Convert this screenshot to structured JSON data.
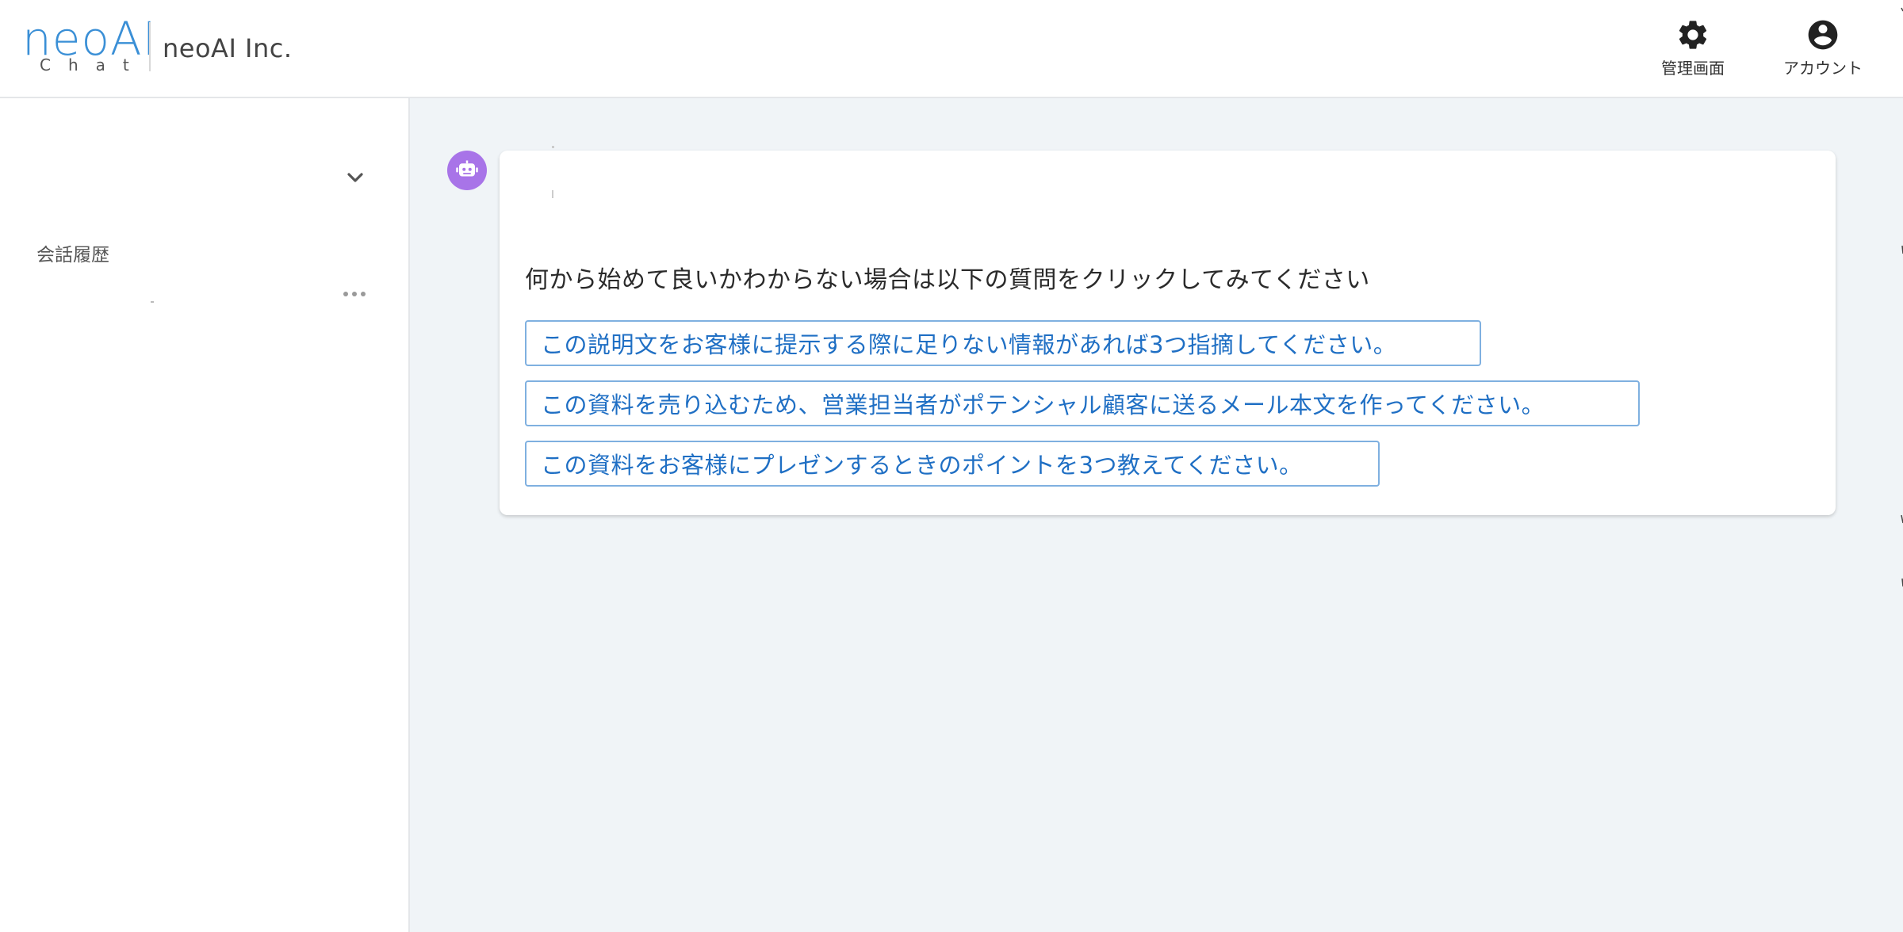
{
  "header": {
    "logo_main": "neoAI",
    "logo_sub": "Chat",
    "company": "neoAI Inc.",
    "admin_label": "管理画面",
    "account_label": "アカウント",
    "admin_icon": "gear-icon",
    "account_icon": "account-circle-icon"
  },
  "sidebar": {
    "selector_icon": "chevron-down-icon",
    "history_title": "会話履歴",
    "item_menu_icon": "more-horizontal-icon"
  },
  "chat": {
    "avatar_icon": "robot-icon",
    "avatar_color": "#a874e8",
    "prompt": "何から始めて良いかわからない場合は以下の質問をクリックしてみてください",
    "suggestions": [
      "この説明文をお客様に提示する際に足りない情報があれば3つ指摘してください。",
      "この資料を売り込むため、営業担当者がポテンシャル顧客に送るメール本文を作ってください。",
      "この資料をお客様にプレゼンするときのポイントを3つ教えてください。"
    ]
  },
  "colors": {
    "accent": "#1f6fc4",
    "button_border": "#7fb0e0",
    "main_bg": "#f0f4f7"
  }
}
